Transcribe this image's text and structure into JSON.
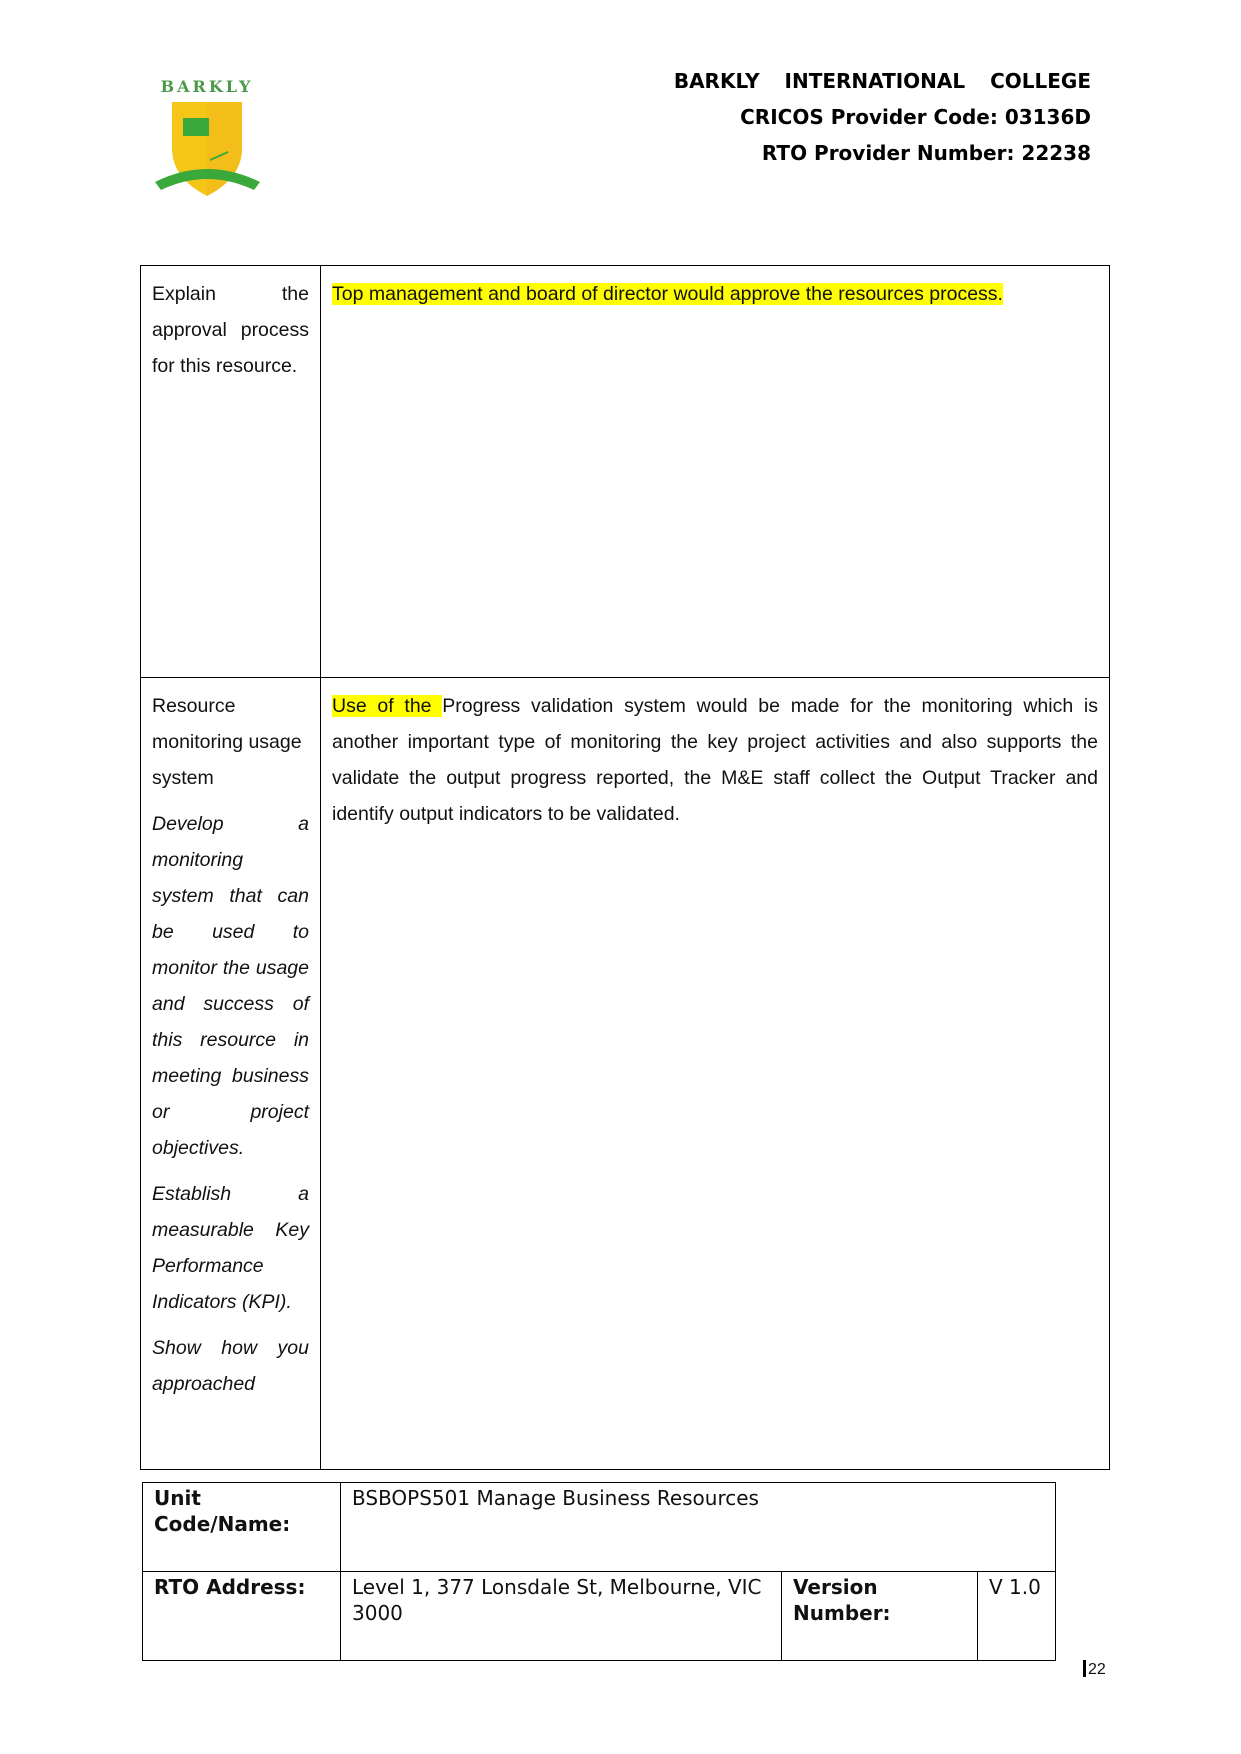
{
  "header": {
    "logo_text": "BARKLY",
    "institution": "BARKLY INTERNATIONAL COLLEGE",
    "cricos": "CRICOS Provider Code: 03136D",
    "rto": "RTO Provider Number: 22238",
    "colors": {
      "shield": "#f5c518",
      "ribbon": "#3aa83a",
      "logo_text": "#4a9a4a"
    }
  },
  "main_table": {
    "rows": [
      {
        "question": [
          "Explain the approval process for this resource."
        ],
        "answer_highlight": "Top management and board of director would approve the resources process.",
        "answer_rest": ""
      },
      {
        "question_title": "Resource monitoring usage system",
        "question_italic": [
          "Develop a monitoring system that can be used to monitor the usage and success of this resource in meeting business or project objectives.",
          "Establish a measurable Key Performance Indicators (KPI).",
          "Show how you approached"
        ],
        "answer_highlight": "Use of the ",
        "answer_rest": "Progress validation system would be made for the monitoring which is another important type of monitoring the key project activities and also supports the validate the output progress reported, the M&E staff collect the Output Tracker and identify output indicators to be validated."
      }
    ],
    "highlight_color": "#ffff00"
  },
  "footer": {
    "unit_label": "Unit Code/Name:",
    "unit_value": "BSBOPS501 Manage Business Resources",
    "address_label": "RTO Address:",
    "address_value": "Level 1, 377 Lonsdale St, Melbourne, VIC 3000",
    "version_label": "Version Number:",
    "version_value": "V 1.0"
  },
  "page_number": "22"
}
